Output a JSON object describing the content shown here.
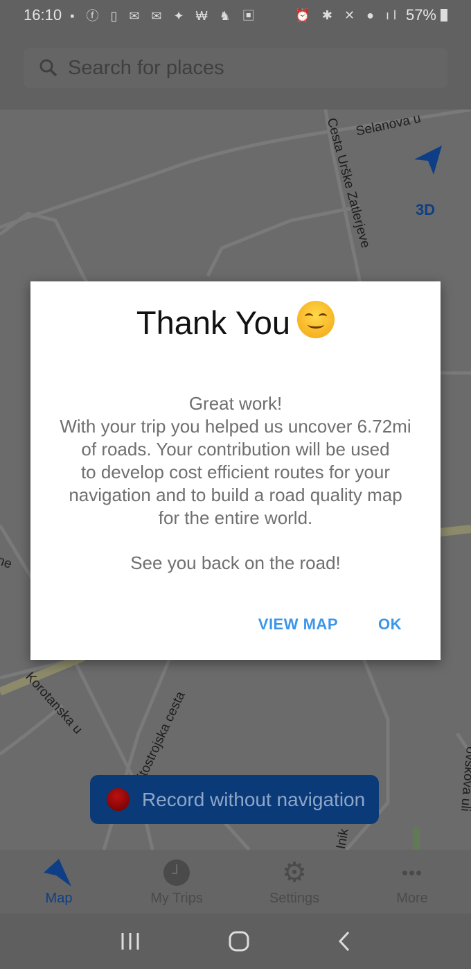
{
  "status_bar": {
    "time": "16:10",
    "notification_icons": "deezer facebook drink outlook gmail twitter washington-post app gallery",
    "system_icons": "alarm bluetooth mute location 4G+ signal",
    "battery": "57%"
  },
  "search": {
    "placeholder": "Search for places"
  },
  "map": {
    "labels": {
      "selanova": "Selanova u",
      "cesta": "Cesta Urške Zatlerjeve",
      "korotanska": "Korotanska u",
      "litostrojska": "itostrojska cesta",
      "nik": "Inik",
      "ovskova": "ovškova uli",
      "ne": "ne"
    },
    "view_3d": "3D",
    "accent": "#0e3f86"
  },
  "record_button": {
    "label": "Record without navigation"
  },
  "dialog": {
    "title": "Thank You",
    "emoji": "smiling-face",
    "lines": [
      "Great work!",
      "With your trip you helped us uncover 6.72mi",
      "of roads. Your contribution will be used",
      "to develop cost efficient routes for your",
      "navigation and to build a road quality map",
      "for the entire world."
    ],
    "closing": "See you back on the road!",
    "view_map": "VIEW MAP",
    "ok": "OK",
    "button_color": "#3b95ea"
  },
  "bottom_nav": {
    "items": [
      {
        "label": "Map",
        "icon": "navigation-arrow-icon",
        "active": true
      },
      {
        "label": "My Trips",
        "icon": "clock-icon",
        "active": false
      },
      {
        "label": "Settings",
        "icon": "gear-icon",
        "active": false
      },
      {
        "label": "More",
        "icon": "more-dots-icon",
        "active": false
      }
    ]
  }
}
